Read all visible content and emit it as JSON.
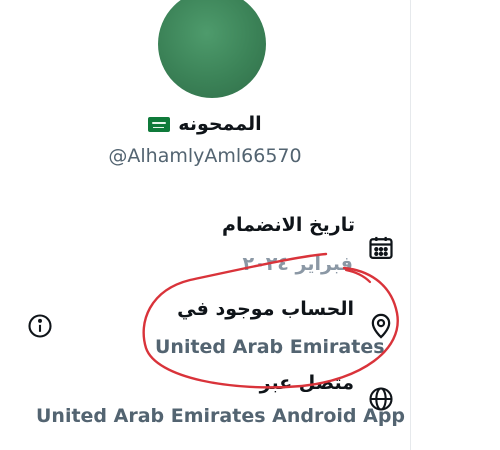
{
  "profile": {
    "name": "الممحونه",
    "handle": "@AlhamlyAml66570"
  },
  "about": {
    "joined_label": "تاريخ الانضمام",
    "joined_value": "فبراير ٢٠٢٤",
    "location_label": "الحساب موجود في",
    "location_value": "United Arab Emirates",
    "connected_label": "متصل عبر",
    "connected_value": "United Arab Emirates Android App"
  },
  "icons": {
    "calendar": "calendar-icon",
    "location": "location-pin-icon",
    "info": "info-icon",
    "globe": "globe-icon",
    "flag": "saudi-flag-icon"
  },
  "colors": {
    "primary_text": "#0f1419",
    "secondary_text": "#536471",
    "annotation": "#d9333a",
    "avatar": "#3b8257"
  }
}
